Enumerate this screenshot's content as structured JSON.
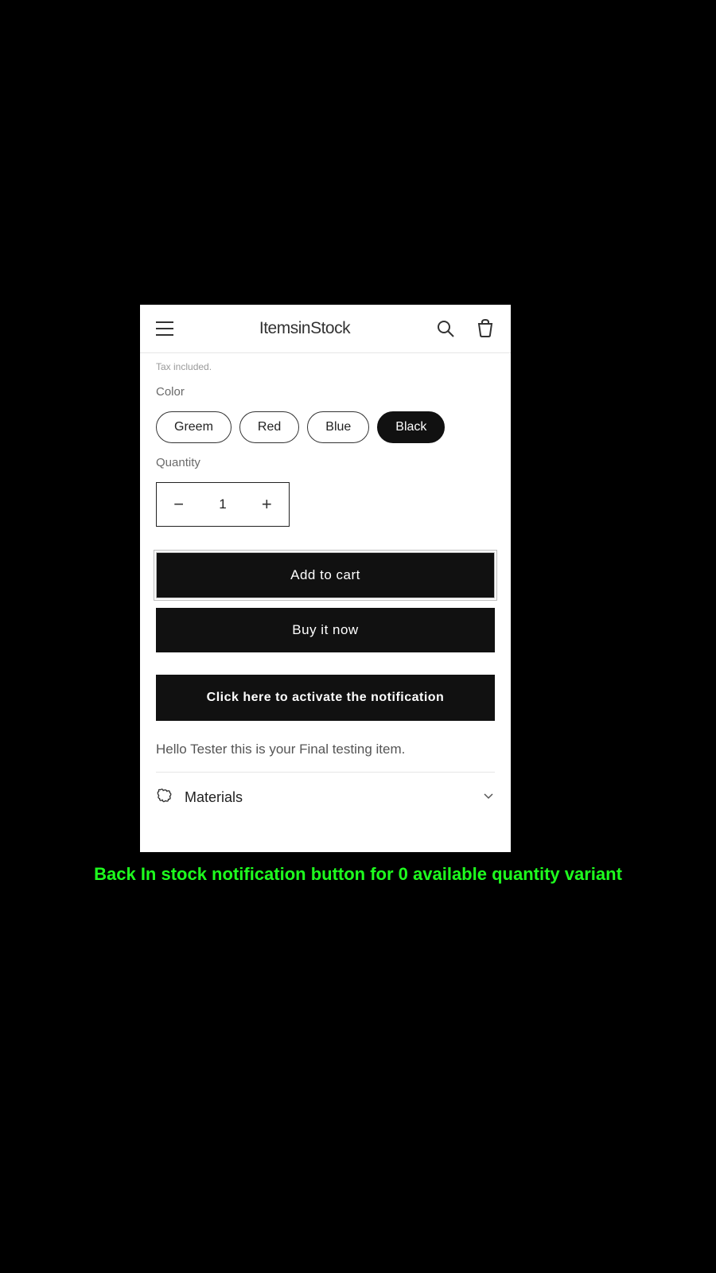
{
  "header": {
    "brand": "ItemsinStock"
  },
  "product": {
    "tax_note": "Tax included.",
    "color_label": "Color",
    "colors": [
      "Greem",
      "Red",
      "Blue",
      "Black"
    ],
    "selected_color": "Black",
    "quantity_label": "Quantity",
    "quantity_value": "1",
    "add_to_cart_label": "Add to cart",
    "buy_now_label": "Buy it now",
    "notify_label": "Click here to activate the notification",
    "description": "Hello Tester this is your Final testing item.",
    "materials_label": "Materials"
  },
  "caption": "Back In stock notification button for 0 available quantity variant"
}
